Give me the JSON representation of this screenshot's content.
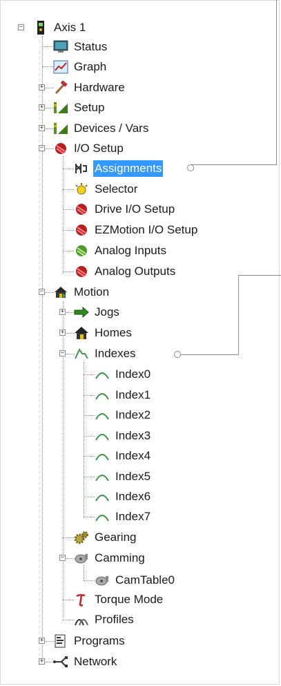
{
  "tree": {
    "axis": "Axis 1",
    "status": "Status",
    "graph": "Graph",
    "hardware": "Hardware",
    "setup": "Setup",
    "devices_vars": "Devices / Vars",
    "io_setup": "I/O Setup",
    "assignments": "Assignments",
    "selector": "Selector",
    "drive_io_setup": "Drive I/O Setup",
    "ezmotion_io_setup": "EZMotion I/O Setup",
    "analog_inputs": "Analog Inputs",
    "analog_outputs": "Analog Outputs",
    "motion": "Motion",
    "jogs": "Jogs",
    "homes": "Homes",
    "indexes": "Indexes",
    "index_items": [
      "Index0",
      "Index1",
      "Index2",
      "Index3",
      "Index4",
      "Index5",
      "Index6",
      "Index7"
    ],
    "gearing": "Gearing",
    "camming": "Camming",
    "camtable0": "CamTable0",
    "torque_mode": "Torque Mode",
    "profiles": "Profiles",
    "programs": "Programs",
    "network": "Network"
  },
  "expanders": {
    "expanded": "−",
    "collapsed": "+"
  },
  "colors": {
    "selection": "#3399ff",
    "tree_lines": "#8d8d8d",
    "callout": "#888888"
  },
  "icons": {
    "axis": "axis-drive-icon",
    "status": "monitor-icon",
    "graph": "graph-icon",
    "hardware": "hammer-icon",
    "setup": "setup-icon",
    "io": "red-io-icon",
    "assignments": "assignments-icon",
    "selector": "selector-bulb-icon",
    "analog_in": "green-analog-icon",
    "motion": "motion-house-icon",
    "jogs": "green-arrow-icon",
    "homes": "house-icon",
    "index": "index-profile-icon",
    "gearing": "gear-icon",
    "camming": "cam-icon",
    "torque": "torque-icon",
    "profiles": "profiles-icon",
    "programs": "program-icon",
    "network": "network-icon"
  }
}
